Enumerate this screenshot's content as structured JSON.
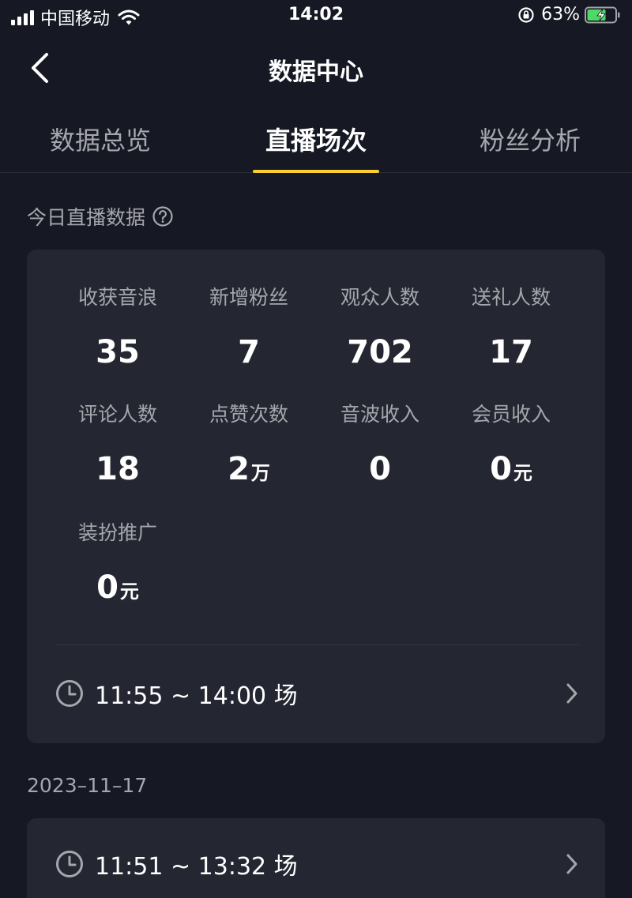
{
  "status_bar": {
    "carrier": "中国移动",
    "time": "14:02",
    "battery": "63%"
  },
  "nav": {
    "title": "数据中心"
  },
  "tabs": [
    {
      "label": "数据总览",
      "active": false
    },
    {
      "label": "直播场次",
      "active": true
    },
    {
      "label": "粉丝分析",
      "active": false
    }
  ],
  "today": {
    "section_label": "今日直播数据",
    "stats": [
      {
        "label": "收获音浪",
        "value": "35",
        "unit": ""
      },
      {
        "label": "新增粉丝",
        "value": "7",
        "unit": ""
      },
      {
        "label": "观众人数",
        "value": "702",
        "unit": ""
      },
      {
        "label": "送礼人数",
        "value": "17",
        "unit": ""
      },
      {
        "label": "评论人数",
        "value": "18",
        "unit": ""
      },
      {
        "label": "点赞次数",
        "value": "2",
        "unit": "万"
      },
      {
        "label": "音波收入",
        "value": "0",
        "unit": ""
      },
      {
        "label": "会员收入",
        "value": "0",
        "unit": "元"
      },
      {
        "label": "装扮推广",
        "value": "0",
        "unit": "元"
      }
    ],
    "session": "11:55 ~ 14:00 场"
  },
  "history": [
    {
      "date": "2023–11–17",
      "sessions": [
        "11:51 ~ 13:32 场"
      ]
    }
  ],
  "colors": {
    "background": "#161823",
    "card": "#242631",
    "accent": "#fbcf33",
    "text_primary": "#ffffff",
    "text_secondary": "#a6a7ad",
    "battery_fill": "#4cd964"
  },
  "icons": {
    "back": "chevron-left-icon",
    "help": "question-circle-icon",
    "clock": "clock-icon",
    "chevron": "chevron-right-icon",
    "wifi": "wifi-icon",
    "signal": "signal-icon",
    "battery": "battery-charging-icon",
    "lock": "lock-rotation-icon"
  }
}
